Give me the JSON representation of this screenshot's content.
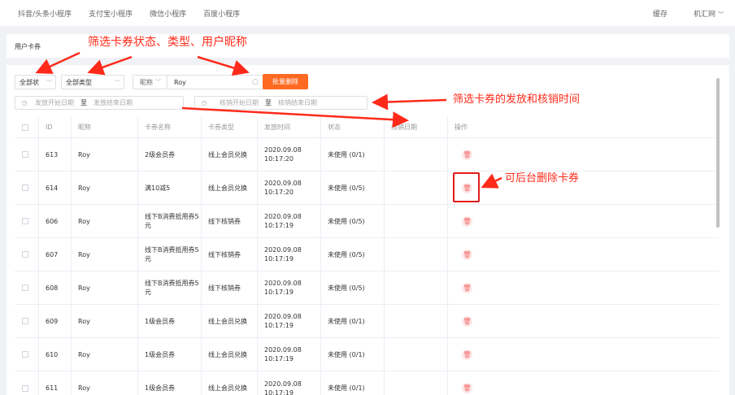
{
  "top_tabs": [
    "抖音/头条小程序",
    "支付宝小程序",
    "微信小程序",
    "百度小程序"
  ],
  "top_right": {
    "cache": "缓存",
    "user": "机汇网"
  },
  "page_title": "用户卡券",
  "filters": {
    "status": "全部状",
    "type": "全部类型",
    "search_field": "昵称",
    "search_value": "Roy",
    "batch_delete": "批量删除",
    "issue_start": "发放开始日期",
    "issue_sep": "至",
    "issue_end": "发放结束日期",
    "verify_start": "核销开始日期",
    "verify_sep": "至",
    "verify_end": "核销结束日期"
  },
  "table": {
    "headers": [
      "ID",
      "昵称",
      "卡券名称",
      "卡券类型",
      "发放时间",
      "状态",
      "核销日期",
      "操作"
    ],
    "rows": [
      {
        "id": "613",
        "nick": "Roy",
        "name": "2级会员券",
        "type": "线上会员兑换",
        "time": "2020.09.08 10:17:20",
        "status": "未使用 (0/1)"
      },
      {
        "id": "614",
        "nick": "Roy",
        "name": "满10减5",
        "type": "线上会员兑换",
        "time": "2020.09.08 10:17:20",
        "status": "未使用 (0/5)"
      },
      {
        "id": "606",
        "nick": "Roy",
        "name": "线下B消费抵用券5元",
        "type": "线下核销券",
        "time": "2020.09.08 10:17:19",
        "status": "未使用 (0/5)"
      },
      {
        "id": "607",
        "nick": "Roy",
        "name": "线下B消费抵用券5元",
        "type": "线下核销券",
        "time": "2020.09.08 10:17:19",
        "status": "未使用 (0/5)"
      },
      {
        "id": "608",
        "nick": "Roy",
        "name": "线下B消费抵用券5元",
        "type": "线下核销券",
        "time": "2020.09.08 10:17:19",
        "status": "未使用 (0/5)"
      },
      {
        "id": "609",
        "nick": "Roy",
        "name": "1级会员券",
        "type": "线上会员兑换",
        "time": "2020.09.08 10:17:19",
        "status": "未使用 (0/1)"
      },
      {
        "id": "610",
        "nick": "Roy",
        "name": "1级会员券",
        "type": "线上会员兑换",
        "time": "2020.09.08 10:17:19",
        "status": "未使用 (0/1)"
      },
      {
        "id": "611",
        "nick": "Roy",
        "name": "1级会员券",
        "type": "线上会员兑换",
        "time": "2020.09.08 10:17:19",
        "status": "未使用 (0/1)"
      }
    ]
  },
  "annotations": {
    "filter_note": "筛选卡券状态、类型、用户昵称",
    "date_note": "筛选卡券的发放和核销时间",
    "delete_note": "可后台删除卡券"
  },
  "colors": {
    "accent": "#ff6a22",
    "annotation": "#ff2a1a",
    "danger": "#f56c6c"
  },
  "icons": [
    "clock-icon",
    "search-icon",
    "trash-icon",
    "chevron-down-icon"
  ]
}
